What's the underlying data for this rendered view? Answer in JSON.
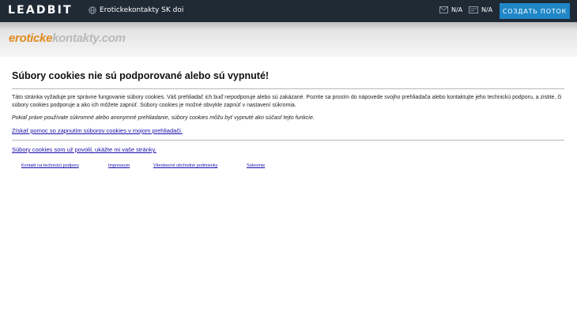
{
  "topbar": {
    "logo": "LEADBIT",
    "site_name": "Erotickekontakty SK doi",
    "stat1_value": "N/A",
    "stat2_value": "N/A",
    "create_button": "СОЗДАТЬ ПОТОК",
    "background": "#1f2a35",
    "button_color": "#1f86c7"
  },
  "brand": {
    "part1": "eroticke",
    "part2": "kontakty.com",
    "color1": "#e08a1e",
    "color2": "#b9b9b9"
  },
  "page": {
    "heading": "Súbory cookies nie sú podporované alebo sú vypnuté!",
    "paragraph1": "Táto stránka vyžaduje pre správne fungovanie súbory cookies. Váš prehliadač ich buď nepodporuje alebo sú zakázané. Pozrite sa prosím do nápovede svojho prehliadača alebo kontaktujte jeho technickú podporu, a zistite, či súbory cookies podporuje a ako ich môžete zapnúť. Súbory cookies je možné obvykle zapnúť v nastavení súkromia.",
    "paragraph2": "Pokiaľ práve používate súkromné alebo anonymné prehliadanie, súbory cookies môžu byť vypnuté ako súčasť tejto funkcie.",
    "help_link": "Získať pomoc so zapnutím súborov cookies v mojom prehliadači.",
    "enabled_link": "Súbory cookies som už povolil, ukážte mi vaše stránky."
  },
  "footer": {
    "links": [
      "Kontakt na technickú podporu",
      "Impressum",
      "Všeobecné obchodné podmienky",
      "Súkromie"
    ]
  },
  "icons": {
    "site": "globe-icon",
    "stat1": "mail-icon",
    "stat2": "wallet-icon"
  }
}
